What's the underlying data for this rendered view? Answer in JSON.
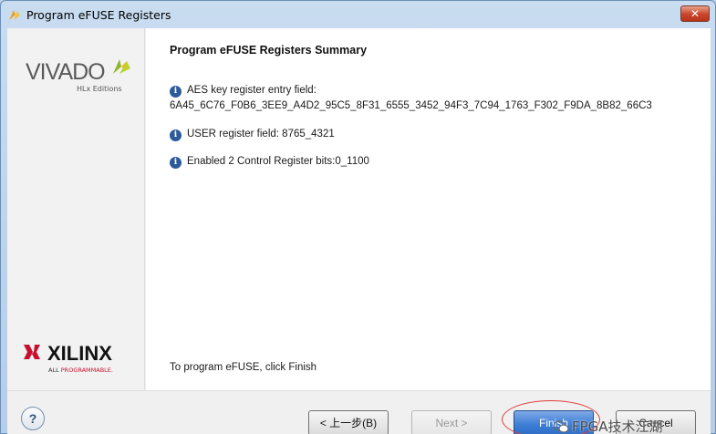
{
  "window": {
    "title": "Program eFUSE Registers"
  },
  "sidebar": {
    "vivado_wordmark": "VIVADO",
    "vivado_edition": "HLx Editions",
    "xilinx_wordmark": "XILINX",
    "xilinx_tagline_a": "ALL ",
    "xilinx_tagline_b": "PROGRAMMABLE."
  },
  "summary": {
    "heading": "Program eFUSE Registers Summary",
    "aes_label": "AES key register entry field:",
    "aes_value": "6A45_6C76_F0B6_3EE9_A4D2_95C5_8F31_6555_3452_94F3_7C94_1763_F302_F9DA_8B82_66C3",
    "user_field": "USER register field: 8765_4321",
    "control_bits": "Enabled 2 Control Register bits:0_1100",
    "footer_note": "To program eFUSE, click Finish"
  },
  "buttons": {
    "help": "?",
    "back": "< 上一步(B)",
    "next": "Next >",
    "finish": "Finish",
    "cancel": "Cancel"
  },
  "watermark": {
    "text": "FPGA技术江湖"
  },
  "colors": {
    "primary_button": "#3f7fd6",
    "highlight_ring": "#e23b3b",
    "info_icon": "#2d5a9a"
  }
}
